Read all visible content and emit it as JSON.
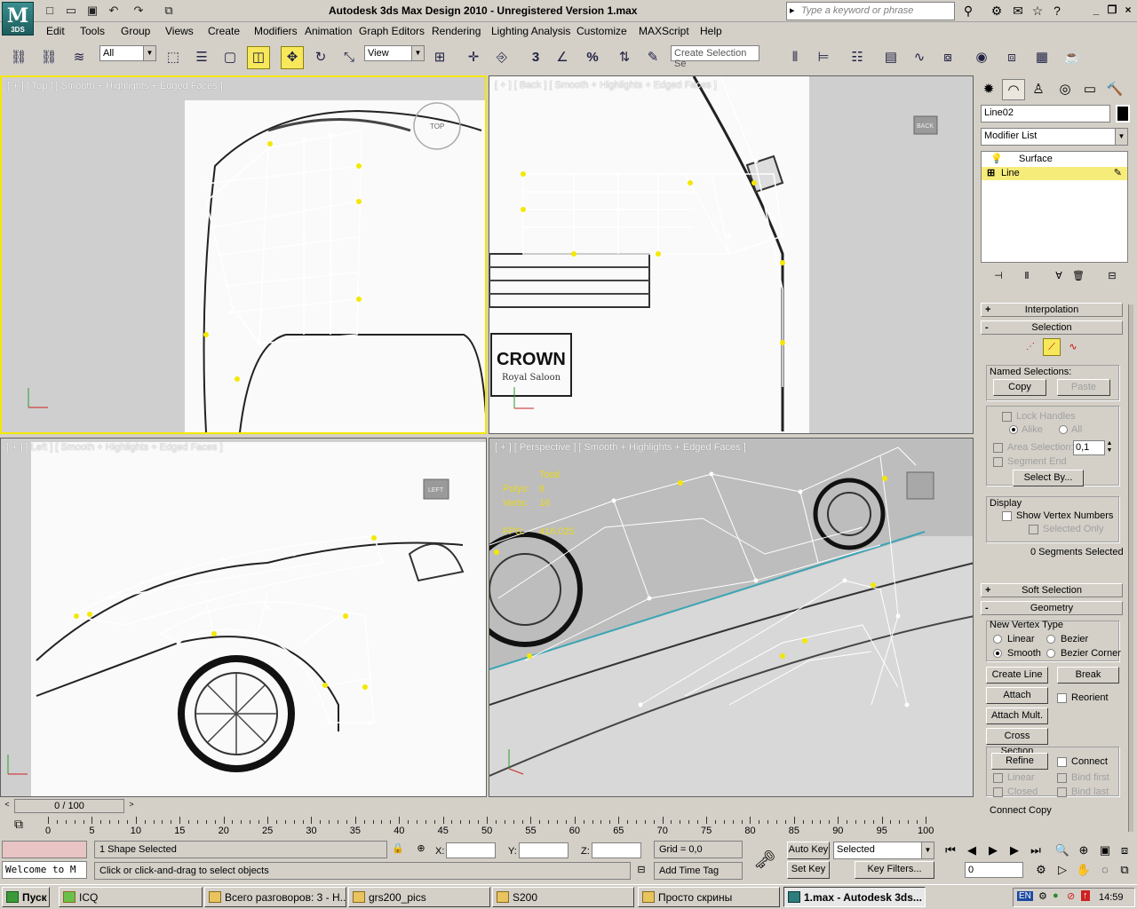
{
  "app": {
    "logo": "M",
    "logo_sub": "3DS",
    "title": "Autodesk 3ds Max Design 2010  -  Unregistered Version    1.max",
    "search_placeholder": "Type a keyword or phrase"
  },
  "menu": [
    "Edit",
    "Tools",
    "Group",
    "Views",
    "Create",
    "Modifiers",
    "Animation",
    "Graph Editors",
    "Rendering",
    "Lighting Analysis",
    "Customize",
    "MAXScript",
    "Help"
  ],
  "toolbar": {
    "filter_value": "All",
    "ref_coord": "View",
    "selection_set_placeholder": "Create Selection Se",
    "snap_value": "3",
    "angle_value": "%"
  },
  "viewports": {
    "top": {
      "label": "[ + ] [ Top ] [ Smooth + Highlights + Edged Faces ]",
      "cube": "TOP"
    },
    "back": {
      "label": "[ + ] [ Back ] [ Smooth + Highlights + Edged Faces ]",
      "cube": "BACK",
      "plate": "CROWN",
      "plate_sub": "Royal Saloon"
    },
    "left": {
      "label": "[ + ] [ Left ] [ Smooth + Highlights + Edged Faces ]",
      "cube": "LEFT"
    },
    "persp": {
      "label": "[ + ] [ Perspective ] [ Smooth + Highlights + Edged Faces ]",
      "stats": {
        "total": "Total",
        "polys_label": "Polys:",
        "polys": "8",
        "verts_label": "Verts:",
        "verts": "16",
        "fps_label": "FPS:",
        "fps": "416.025"
      }
    }
  },
  "cmd": {
    "object_name": "Line02",
    "modifier_list": "Modifier List",
    "stack": [
      "Surface",
      "Line"
    ],
    "rollouts": {
      "interpolation": "Interpolation",
      "selection": "Selection",
      "soft_selection": "Soft Selection",
      "geometry": "Geometry"
    },
    "named_selections": "Named Selections:",
    "copy": "Copy",
    "paste": "Paste",
    "lock_handles": "Lock Handles",
    "alike": "Alike",
    "all": "All",
    "area_selection": "Area Selection:",
    "area_value": "0,1",
    "segment_end": "Segment End",
    "select_by": "Select By...",
    "display": "Display",
    "show_vertex_numbers": "Show Vertex Numbers",
    "selected_only": "Selected Only",
    "segments_selected": "0 Segments Selected",
    "new_vertex_type": "New Vertex Type",
    "linear": "Linear",
    "bezier": "Bezier",
    "smooth": "Smooth",
    "bezier_corner": "Bezier Corner",
    "create_line": "Create Line",
    "break": "Break",
    "attach": "Attach",
    "reorient": "Reorient",
    "attach_mult": "Attach Mult.",
    "cross_section": "Cross Section",
    "refine": "Refine",
    "connect": "Connect",
    "linear2": "Linear",
    "bind_first": "Bind first",
    "closed": "Closed",
    "bind_last": "Bind last",
    "connect_copy": "Connect Copy"
  },
  "timeline": {
    "slider": "0 / 100",
    "ticks": [
      "0",
      "5",
      "10",
      "15",
      "20",
      "25",
      "30",
      "35",
      "40",
      "45",
      "50",
      "55",
      "60",
      "65",
      "70",
      "75",
      "80",
      "85",
      "90",
      "95",
      "100"
    ]
  },
  "status": {
    "maxscript": "Welcome to M",
    "selected": "1 Shape Selected",
    "prompt": "Click or click-and-drag to select objects",
    "x_label": "X:",
    "y_label": "Y:",
    "z_label": "Z:",
    "grid": "Grid = 0,0",
    "add_time_tag": "Add Time Tag",
    "auto_key": "Auto Key",
    "set_key": "Set Key",
    "key_mode": "Selected",
    "key_filters": "Key Filters...",
    "frame": "0"
  },
  "taskbar": {
    "start": "Пуск",
    "tasks": [
      "ICQ",
      "Всего разговоров: 3 - Н...",
      "grs200_pics",
      "S200",
      "Просто скрины",
      "1.max - Autodesk 3ds..."
    ],
    "lang": "EN",
    "clock": "14:59"
  }
}
